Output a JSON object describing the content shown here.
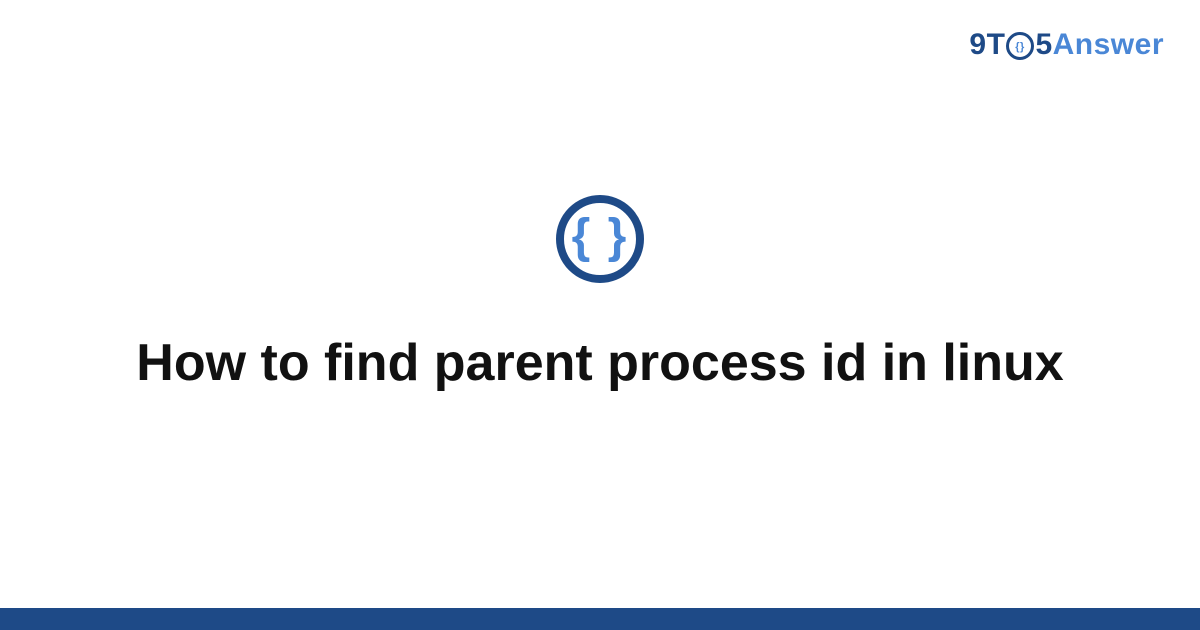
{
  "brand": {
    "part1": "9T",
    "part2": "5",
    "answer": "Answer",
    "inner_icon": "braces-icon"
  },
  "logo": {
    "glyph": "{ }"
  },
  "headline": "How to find parent process id in linux",
  "colors": {
    "brand_dark": "#1e4a87",
    "brand_light": "#4a87d6",
    "text": "#111111",
    "bg": "#ffffff"
  }
}
